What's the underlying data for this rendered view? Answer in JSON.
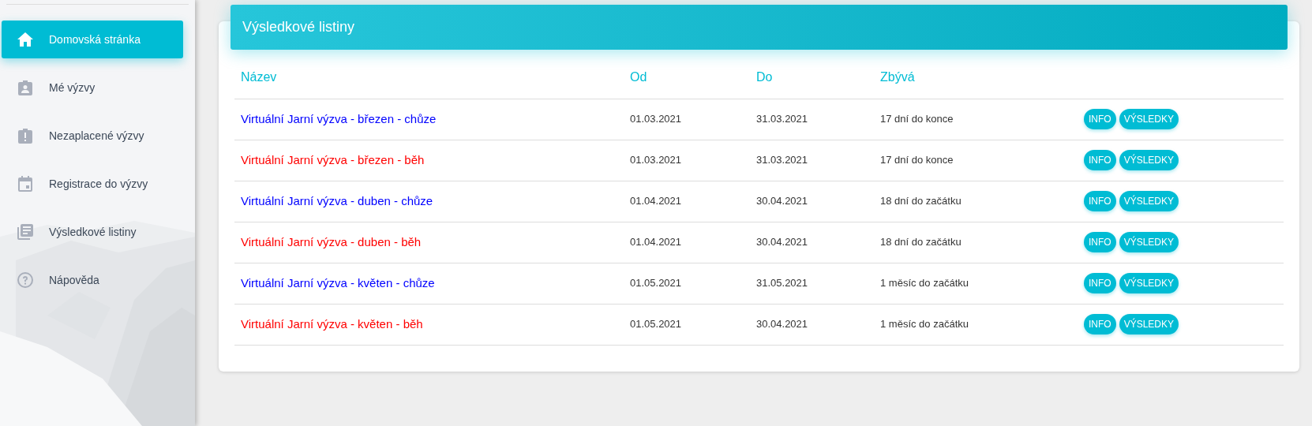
{
  "sidebar": {
    "items": [
      {
        "label": "Domovská stránka",
        "selected": true
      },
      {
        "label": "Mé výzvy",
        "selected": false
      },
      {
        "label": "Nezaplacené výzvy",
        "selected": false
      },
      {
        "label": "Registrace do výzvy",
        "selected": false
      },
      {
        "label": "Výsledkové listiny",
        "selected": false
      },
      {
        "label": "Nápověda",
        "selected": false
      }
    ]
  },
  "card": {
    "title": "Výsledkové listiny",
    "table": {
      "columns": [
        "Název",
        "Od",
        "Do",
        "Zbývá"
      ],
      "rows": [
        {
          "name": "Virtuální Jarní výzva - březen - chůze",
          "color": "#0000ff",
          "from": "01.03.2021",
          "to": "31.03.2021",
          "remaining": "17 dní do konce",
          "buttons": [
            "INFO",
            "VÝSLEDKY"
          ]
        },
        {
          "name": "Virtuální Jarní výzva - březen - běh",
          "color": "#ff0000",
          "from": "01.03.2021",
          "to": "31.03.2021",
          "remaining": "17 dní do konce",
          "buttons": [
            "INFO",
            "VÝSLEDKY"
          ]
        },
        {
          "name": "Virtuální Jarní výzva - duben - chůze",
          "color": "#0000ff",
          "from": "01.04.2021",
          "to": "30.04.2021",
          "remaining": "18 dní do začátku",
          "buttons": [
            "INFO",
            "VÝSLEDKY"
          ]
        },
        {
          "name": "Virtuální Jarní výzva - duben - běh",
          "color": "#ff0000",
          "from": "01.04.2021",
          "to": "30.04.2021",
          "remaining": "18 dní do začátku",
          "buttons": [
            "INFO",
            "VÝSLEDKY"
          ]
        },
        {
          "name": "Virtuální Jarní výzva - květen - chůze",
          "color": "#0000ff",
          "from": "01.05.2021",
          "to": "31.05.2021",
          "remaining": "1 měsíc do začátku",
          "buttons": [
            "INFO",
            "VÝSLEDKY"
          ]
        },
        {
          "name": "Virtuální Jarní výzva - květen - běh",
          "color": "#ff0000",
          "from": "01.05.2021",
          "to": "30.04.2021",
          "remaining": "1 měsíc do začátku",
          "buttons": [
            "INFO",
            "VÝSLEDKY"
          ]
        }
      ]
    }
  }
}
